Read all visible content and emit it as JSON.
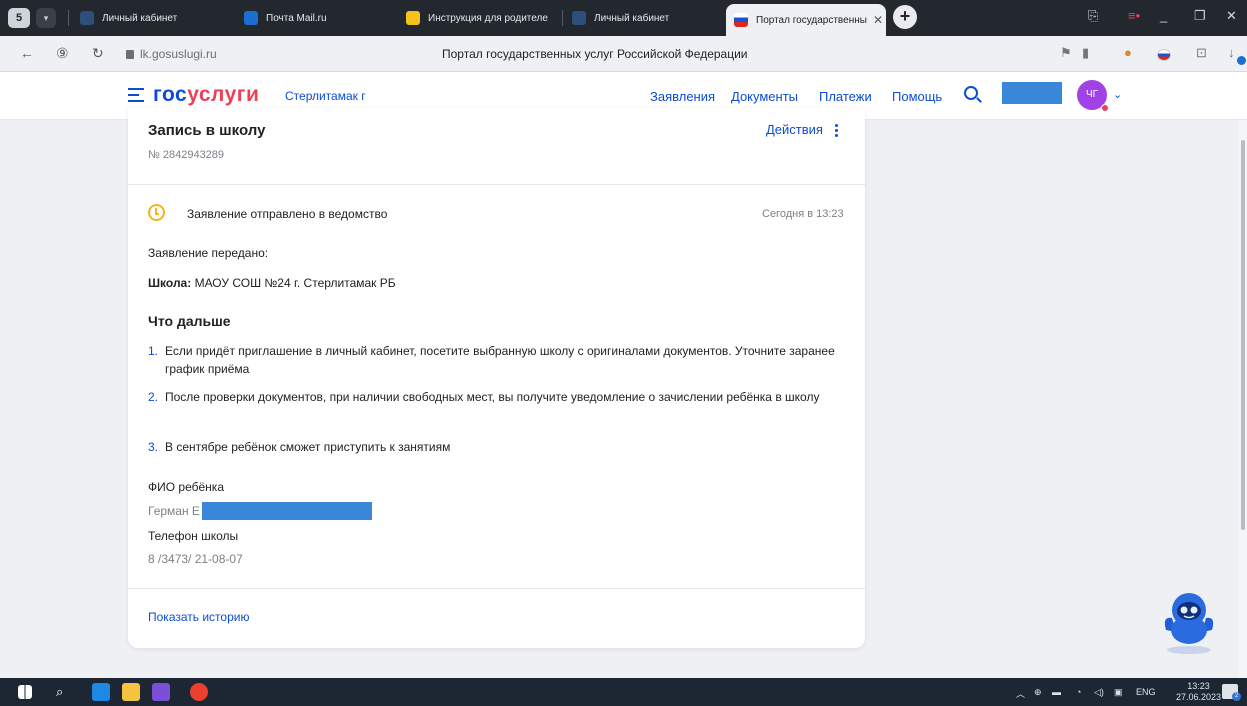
{
  "browser": {
    "app_badge": "5",
    "tabs": [
      {
        "label": "Личный кабинет"
      },
      {
        "label": "Почта Mail.ru"
      },
      {
        "label": "Инструкция для родителе"
      },
      {
        "label": "Личный кабинет"
      },
      {
        "label": "Портал государственны"
      }
    ],
    "url": "lk.gosuslugi.ru",
    "page_title": "Портал государственных услуг Российской Федерации"
  },
  "header": {
    "logo_part1": "гос",
    "logo_part2": "услуги",
    "region": "Стерлитамак г",
    "nav": [
      "Заявления",
      "Документы",
      "Платежи",
      "Помощь"
    ],
    "avatar_initials": "ЧГ"
  },
  "application": {
    "title": "Запись в школу",
    "number": "№ 2842943289",
    "actions_label": "Действия",
    "status": "Заявление отправлено в ведомство",
    "status_time": "Сегодня в 13:23",
    "transferred_label": "Заявление передано:",
    "school_label": "Школа:",
    "school_value": " МАОУ СОШ №24 г. Стерлитамак РБ",
    "next_heading": "Что дальше",
    "steps": [
      {
        "num": "1.",
        "text": "Если придёт приглашение в личный кабинет, посетите выбранную школу с оригиналами документов. Уточните заранее график приёма"
      },
      {
        "num": "2.",
        "text": "После проверки документов, при наличии свободных мест, вы получите уведомление о зачислении ребёнка в школу"
      },
      {
        "num": "3.",
        "text": "В сентябре ребёнок сможет приступить к занятиям"
      }
    ],
    "child_label": "ФИО ребёнка",
    "child_value": "Герман Е",
    "phone_label": "Телефон школы",
    "phone_value": "8 /3473/ 21-08-07",
    "history_link": "Показать историю"
  },
  "taskbar": {
    "lang": "ENG",
    "time": "13:23",
    "date": "27.06.2023",
    "notif_count": "2"
  }
}
